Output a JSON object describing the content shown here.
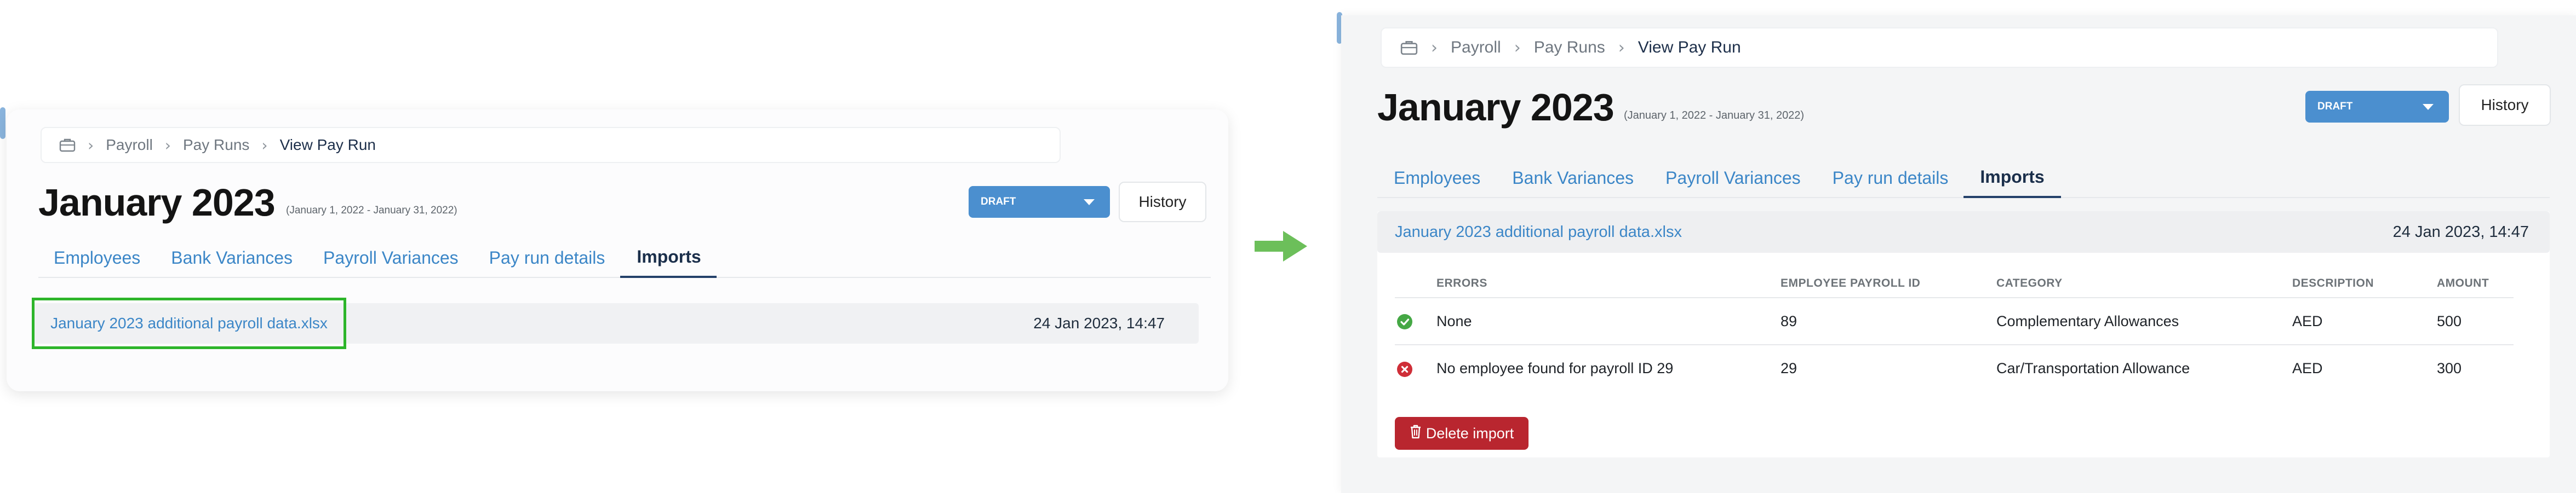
{
  "breadcrumb": {
    "icon": "briefcase-icon",
    "items": [
      "Payroll",
      "Pay Runs",
      "View Pay Run"
    ]
  },
  "header": {
    "title": "January 2023",
    "period": "(January 1, 2022 - January 31, 2022)"
  },
  "status": {
    "value": "DRAFT",
    "color": "#4b8fcf"
  },
  "history_label": "History",
  "tabs": [
    "Employees",
    "Bank Variances",
    "Payroll Variances",
    "Pay run details",
    "Imports"
  ],
  "active_tab": "Imports",
  "import": {
    "file_name": "January 2023 additional payroll data.xlsx",
    "date": "24 Jan 2023, 14:47"
  },
  "table": {
    "headers": {
      "errors": "ERRORS",
      "employee_payroll_id": "EMPLOYEE PAYROLL ID",
      "category": "CATEGORY",
      "description": "DESCRIPTION",
      "amount": "AMOUNT"
    },
    "rows": [
      {
        "status": "success",
        "errors": "None",
        "employee_payroll_id": "89",
        "category": "Complementary Allowances",
        "description": "AED",
        "amount": "500"
      },
      {
        "status": "error",
        "errors": "No employee found for payroll ID 29",
        "employee_payroll_id": "29",
        "category": "Car/Transportation Allowance",
        "description": "AED",
        "amount": "300"
      }
    ]
  },
  "delete_label": "Delete import",
  "colors": {
    "link": "#3b86c7",
    "highlight": "#2db52a",
    "arrow": "#6cbf5a",
    "danger": "#b9262f",
    "success": "#45a845"
  }
}
